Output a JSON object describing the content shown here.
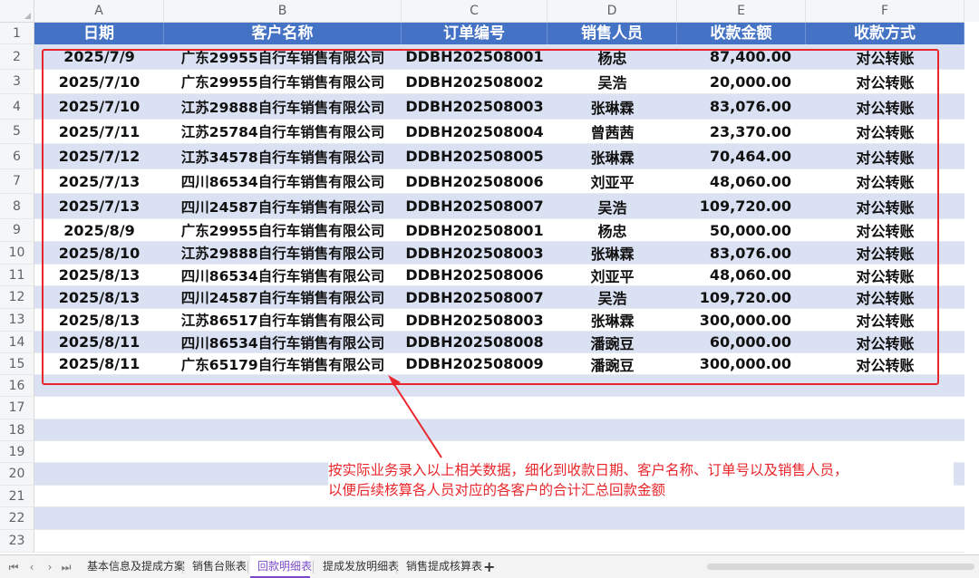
{
  "columns": [
    "A",
    "B",
    "C",
    "D",
    "E",
    "F"
  ],
  "rows_numbers": [
    "1",
    "2",
    "3",
    "4",
    "5",
    "6",
    "7",
    "8",
    "9",
    "10",
    "11",
    "12",
    "13",
    "14",
    "15",
    "16",
    "17",
    "18",
    "19",
    "20",
    "21",
    "22",
    "23"
  ],
  "header": [
    "日期",
    "客户名称",
    "订单编号",
    "销售人员",
    "收款金额",
    "收款方式"
  ],
  "records": [
    [
      "2025/7/9",
      "广东29955自行车销售有限公司",
      "DDBH202508001",
      "杨忠",
      "87,400.00",
      "对公转账"
    ],
    [
      "2025/7/10",
      "广东29955自行车销售有限公司",
      "DDBH202508002",
      "吴浩",
      "20,000.00",
      "对公转账"
    ],
    [
      "2025/7/10",
      "江苏29888自行车销售有限公司",
      "DDBH202508003",
      "张琳霖",
      "83,076.00",
      "对公转账"
    ],
    [
      "2025/7/11",
      "江苏25784自行车销售有限公司",
      "DDBH202508004",
      "曾茜茜",
      "23,370.00",
      "对公转账"
    ],
    [
      "2025/7/12",
      "江苏34578自行车销售有限公司",
      "DDBH202508005",
      "张琳霖",
      "70,464.00",
      "对公转账"
    ],
    [
      "2025/7/13",
      "四川86534自行车销售有限公司",
      "DDBH202508006",
      "刘亚平",
      "48,060.00",
      "对公转账"
    ],
    [
      "2025/7/13",
      "四川24587自行车销售有限公司",
      "DDBH202508007",
      "吴浩",
      "109,720.00",
      "对公转账"
    ],
    [
      "2025/8/9",
      "广东29955自行车销售有限公司",
      "DDBH202508001",
      "杨忠",
      "50,000.00",
      "对公转账"
    ],
    [
      "2025/8/10",
      "江苏29888自行车销售有限公司",
      "DDBH202508003",
      "张琳霖",
      "83,076.00",
      "对公转账"
    ],
    [
      "2025/8/13",
      "四川86534自行车销售有限公司",
      "DDBH202508006",
      "刘亚平",
      "48,060.00",
      "对公转账"
    ],
    [
      "2025/8/13",
      "四川24587自行车销售有限公司",
      "DDBH202508007",
      "吴浩",
      "109,720.00",
      "对公转账"
    ],
    [
      "2025/8/13",
      "江苏86517自行车销售有限公司",
      "DDBH202508003",
      "张琳霖",
      "300,000.00",
      "对公转账"
    ],
    [
      "2025/8/11",
      "四川86534自行车销售有限公司",
      "DDBH202508008",
      "潘豌豆",
      "60,000.00",
      "对公转账"
    ],
    [
      "2025/8/11",
      "广东65179自行车销售有限公司",
      "DDBH202508009",
      "潘豌豆",
      "300,000.00",
      "对公转账"
    ]
  ],
  "annotation": {
    "line1": "按实际业务录入以上相关数据，细化到收款日期、客户名称、订单号以及销售人员，",
    "line2": "以便后续核算各人员对应的各客户的合计汇总回款金额"
  },
  "sheet_tabs": [
    "基本信息及提成方案",
    "销售台账表",
    "回款明细表",
    "提成发放明细表",
    "销售提成核算表"
  ],
  "active_tab": "回款明细表",
  "nav_buttons": [
    "⏮",
    "‹",
    "›",
    "⏭"
  ],
  "add_tab_label": "+",
  "colors": {
    "header_bg": "#4472c4",
    "stripe": "#d9e1f2",
    "callout": "#e8262b",
    "active_tab": "#7b4ac8"
  }
}
